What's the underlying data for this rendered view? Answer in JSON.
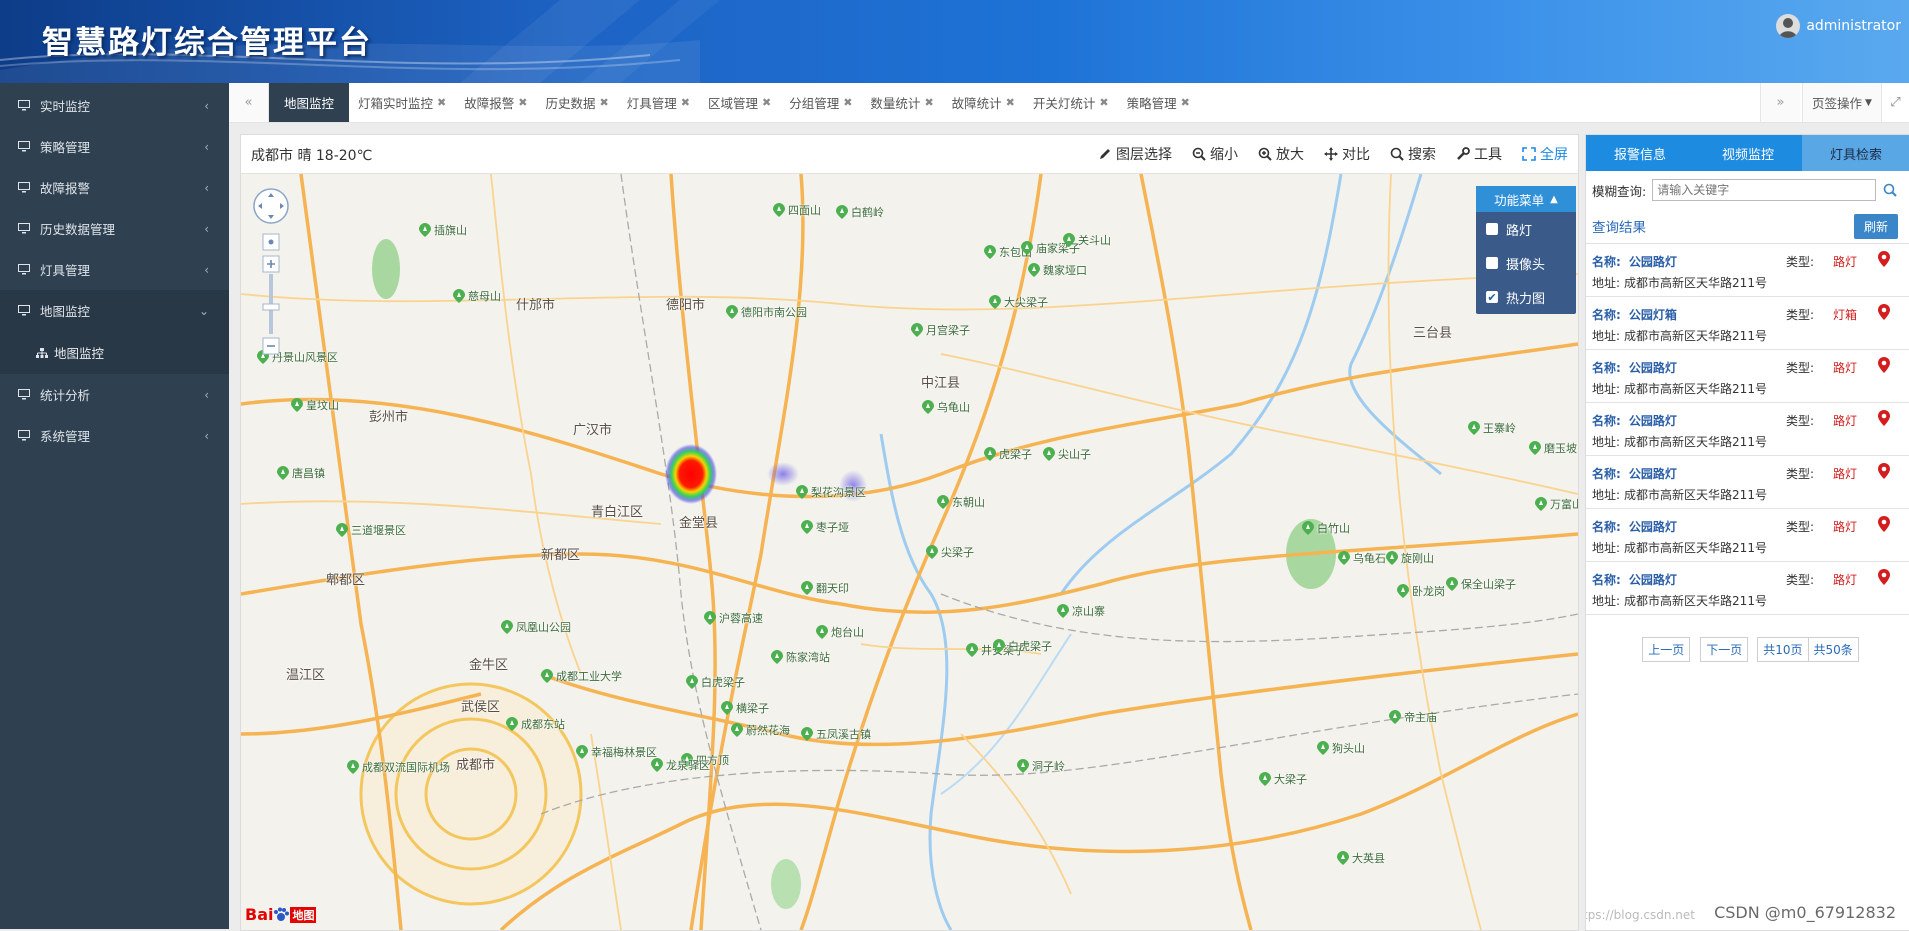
{
  "header": {
    "title": "智慧路灯综合管理平台",
    "username": "administrator"
  },
  "sidebar": {
    "items": [
      {
        "label": "实时监控"
      },
      {
        "label": "策略管理"
      },
      {
        "label": "故障报警"
      },
      {
        "label": "历史数据管理"
      },
      {
        "label": "灯具管理"
      },
      {
        "label": "地图监控"
      },
      {
        "label": "统计分析"
      },
      {
        "label": "系统管理"
      }
    ],
    "sub_item": "地图监控"
  },
  "tabs": {
    "items": [
      "地图监控",
      "灯箱实时监控",
      "故障报警",
      "历史数据",
      "灯具管理",
      "区域管理",
      "分组管理",
      "数量统计",
      "故障统计",
      "开关灯统计",
      "策略管理"
    ],
    "page_ops": "页签操作"
  },
  "map": {
    "weather": "成都市 晴 18-20℃",
    "tools": [
      "图层选择",
      "缩小",
      "放大",
      "对比",
      "搜索",
      "工具",
      "全屏"
    ],
    "func_menu": {
      "title": "功能菜单",
      "items": [
        {
          "label": "路灯",
          "checked": false
        },
        {
          "label": "摄像头",
          "checked": false
        },
        {
          "label": "热力图",
          "checked": true
        }
      ]
    },
    "labels": [
      "德阳市",
      "广汉市",
      "什邡市",
      "彭州市",
      "青白江区",
      "新都区",
      "郫都区",
      "金堂县",
      "中江县",
      "三台县",
      "成都市",
      "温江区",
      "金牛区",
      "武侯区",
      "德阳市南公园",
      "梨花沟景区",
      "枣子垭",
      "月宫梁子",
      "白鹤岭",
      "四面山",
      "乌龟山",
      "东朝山",
      "尖梁子",
      "翻天印",
      "炮台山",
      "陈家湾站",
      "成都工业大学",
      "成都东站",
      "凤凰山公园",
      "三道堰景区",
      "幸福梅林景区",
      "五凤溪古镇",
      "蔚然花海",
      "四方顶",
      "白虎梁子",
      "横梁子",
      "井安梁子",
      "龙泉驿区",
      "沪蓉高速",
      "成都双流国际机场",
      "东包山",
      "庙家梁子",
      "关斗山",
      "魏家垭口",
      "大尖梁子",
      "乌龟石",
      "旋刚山",
      "王寨岭",
      "磨玉坡",
      "万富山",
      "白竹山",
      "凉山寨",
      "卧龙岗",
      "保全山梁子",
      "狗头山",
      "帝主庙",
      "洞子岭",
      "大梁子",
      "大英县",
      "皇坟山",
      "丹景山风景区",
      "慈母山",
      "插旗山",
      "唐昌镇",
      "虎梁子",
      "尖山子",
      "白虎梁子"
    ],
    "baidu": "地图",
    "heatmap_note": ""
  },
  "right_panel": {
    "tabs": [
      "报警信息",
      "视频监控",
      "灯具检索"
    ],
    "active_tab": 2,
    "search_label": "模糊查询:",
    "search_placeholder": "请输入关键字",
    "result_title": "查询结果",
    "refresh": "刷新",
    "name_label": "名称:",
    "type_label": "类型:",
    "addr_label": "地址:",
    "results": [
      {
        "name": "公园路灯",
        "type": "路灯",
        "addr": "成都市高新区天华路211号"
      },
      {
        "name": "公园灯箱",
        "type": "灯箱",
        "addr": "成都市高新区天华路211号"
      },
      {
        "name": "公园路灯",
        "type": "路灯",
        "addr": "成都市高新区天华路211号"
      },
      {
        "name": "公园路灯",
        "type": "路灯",
        "addr": "成都市高新区天华路211号"
      },
      {
        "name": "公园路灯",
        "type": "路灯",
        "addr": "成都市高新区天华路211号"
      },
      {
        "name": "公园路灯",
        "type": "路灯",
        "addr": "成都市高新区天华路211号"
      },
      {
        "name": "公园路灯",
        "type": "路灯",
        "addr": "成都市高新区天华路211号"
      }
    ],
    "pager": {
      "prev": "上一页",
      "next": "下一页",
      "pages": "共10页",
      "total": "共50条"
    }
  },
  "watermark": "CSDN @m0_67912832",
  "watermark_faint": "https://blog.csdn.net"
}
